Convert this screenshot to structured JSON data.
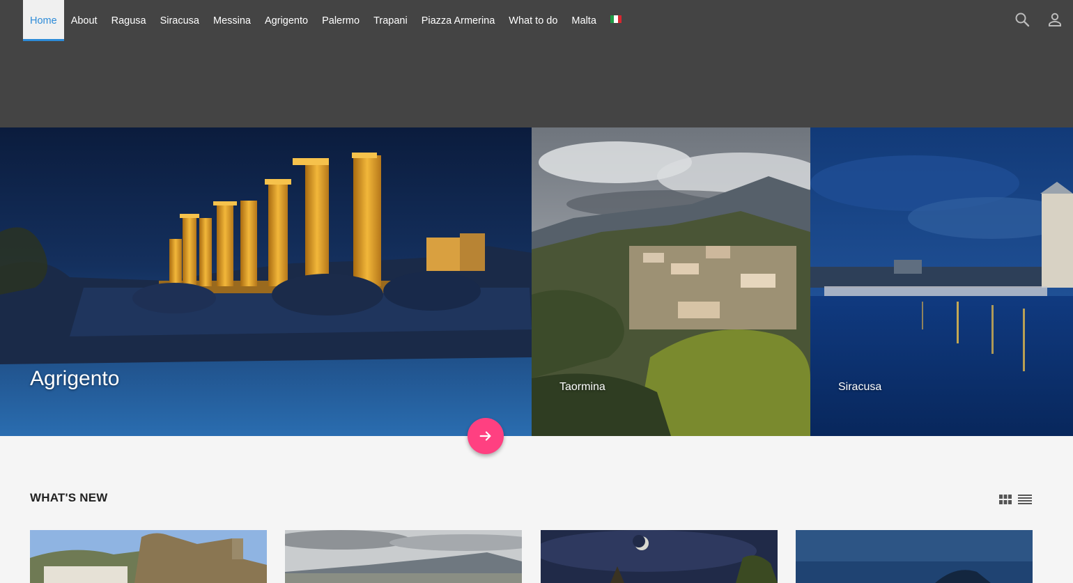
{
  "nav": {
    "items": [
      "Home",
      "About",
      "Ragusa",
      "Siracusa",
      "Messina",
      "Agrigento",
      "Palermo",
      "Trapani",
      "Piazza Armerina",
      "What to do",
      "Malta"
    ],
    "active": "Home",
    "flag": "italian-flag-icon"
  },
  "header_icons": [
    "search-icon",
    "user-icon"
  ],
  "hero": {
    "main_label": "Agrigento",
    "tiles": [
      "Taormina",
      "Siracusa"
    ]
  },
  "section": {
    "title": "WHAT'S NEW",
    "view_icons": [
      "grid-view-icon",
      "list-view-icon"
    ]
  },
  "colors": {
    "header_bg": "#444444",
    "accent": "#2d8bd8",
    "fab": "#ff4081",
    "page_bg": "#f5f5f5"
  }
}
